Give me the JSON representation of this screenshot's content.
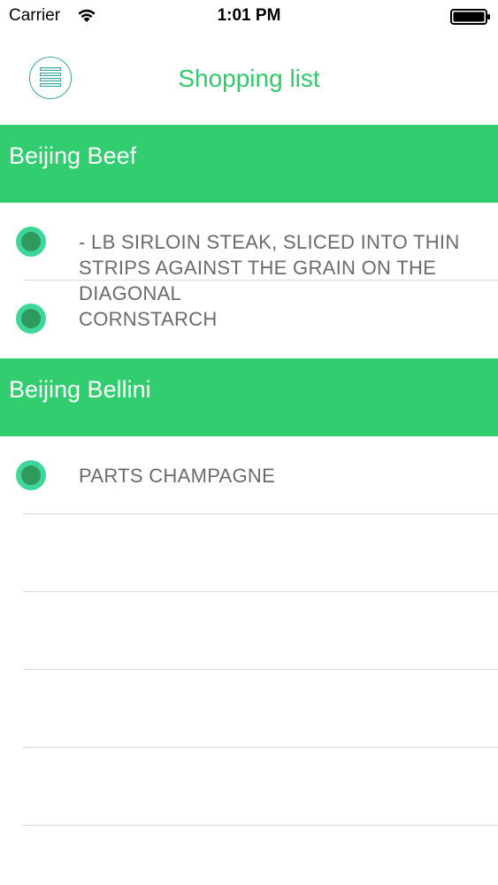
{
  "status_bar": {
    "carrier": "Carrier",
    "time": "1:01 PM",
    "wifi_icon": "wifi-icon",
    "battery_icon": "battery-icon"
  },
  "nav": {
    "title": "Shopping list",
    "menu_icon": "list-menu-icon"
  },
  "colors": {
    "accent_green": "#31cd6f",
    "title_green": "#31c96b",
    "dot_outer": "#3fd69a",
    "dot_inner": "#2f9a5e",
    "item_text": "#6b6b6b",
    "separator": "#d9d9d9"
  },
  "sections": [
    {
      "title": "Beijing Beef",
      "items": [
        "- LB SIRLOIN STEAK, SLICED INTO THIN STRIPS AGAINST THE GRAIN ON THE DIAGONAL",
        "CORNSTARCH"
      ]
    },
    {
      "title": "Beijing Bellini",
      "items": [
        "PARTS CHAMPAGNE"
      ]
    }
  ]
}
